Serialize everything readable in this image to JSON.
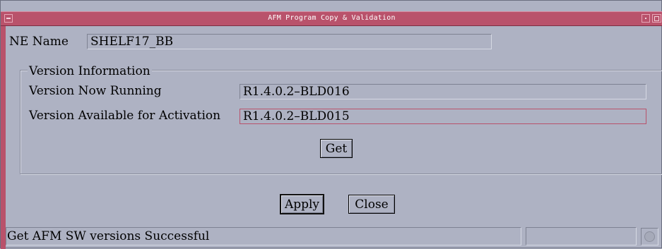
{
  "window": {
    "title": "AFM Program Copy & Validation",
    "title_bar_color": "#b9526b",
    "background_color": "#aeb2c3"
  },
  "ne": {
    "label": "NE Name",
    "value": "SHELF17_BB"
  },
  "version_group": {
    "legend": "Version Information",
    "running_label": "Version Now Running",
    "running_value": "R1.4.0.2–BLD016",
    "available_label": "Version Available for Activation",
    "available_value": "R1.4.0.2–BLD015",
    "get_label": "Get"
  },
  "actions": {
    "apply_label": "Apply",
    "close_label": "Close"
  },
  "status": {
    "message": "Get AFM SW versions Successful",
    "indicator_icon": "status-light-icon"
  }
}
